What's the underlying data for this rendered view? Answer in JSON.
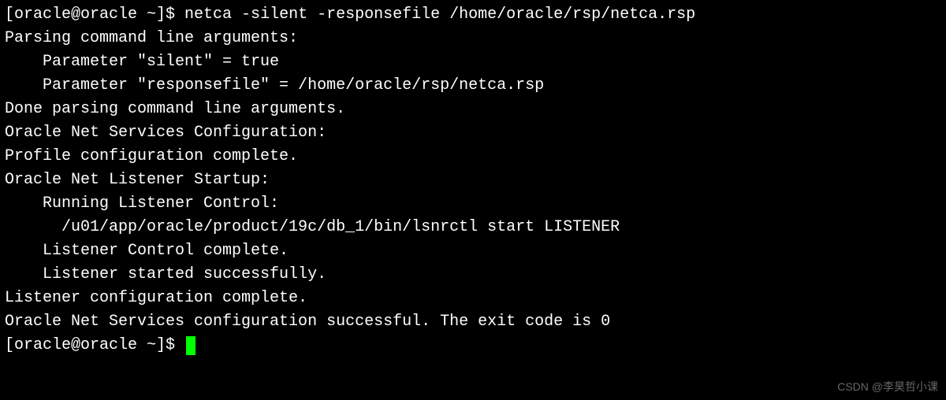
{
  "prompt1": "[oracle@oracle ~]$ ",
  "command": "netca -silent -responsefile /home/oracle/rsp/netca.rsp",
  "blank": "",
  "output": {
    "l1": "Parsing command line arguments:",
    "l2": "    Parameter \"silent\" = true",
    "l3": "    Parameter \"responsefile\" = /home/oracle/rsp/netca.rsp",
    "l4": "Done parsing command line arguments.",
    "l5": "Oracle Net Services Configuration:",
    "l6": "Profile configuration complete.",
    "l7": "Oracle Net Listener Startup:",
    "l8": "    Running Listener Control: ",
    "l9": "      /u01/app/oracle/product/19c/db_1/bin/lsnrctl start LISTENER",
    "l10": "    Listener Control complete.",
    "l11": "    Listener started successfully.",
    "l12": "Listener configuration complete.",
    "l13": "Oracle Net Services configuration successful. The exit code is 0"
  },
  "prompt2": "[oracle@oracle ~]$ ",
  "watermark": "CSDN @李昊哲小课"
}
